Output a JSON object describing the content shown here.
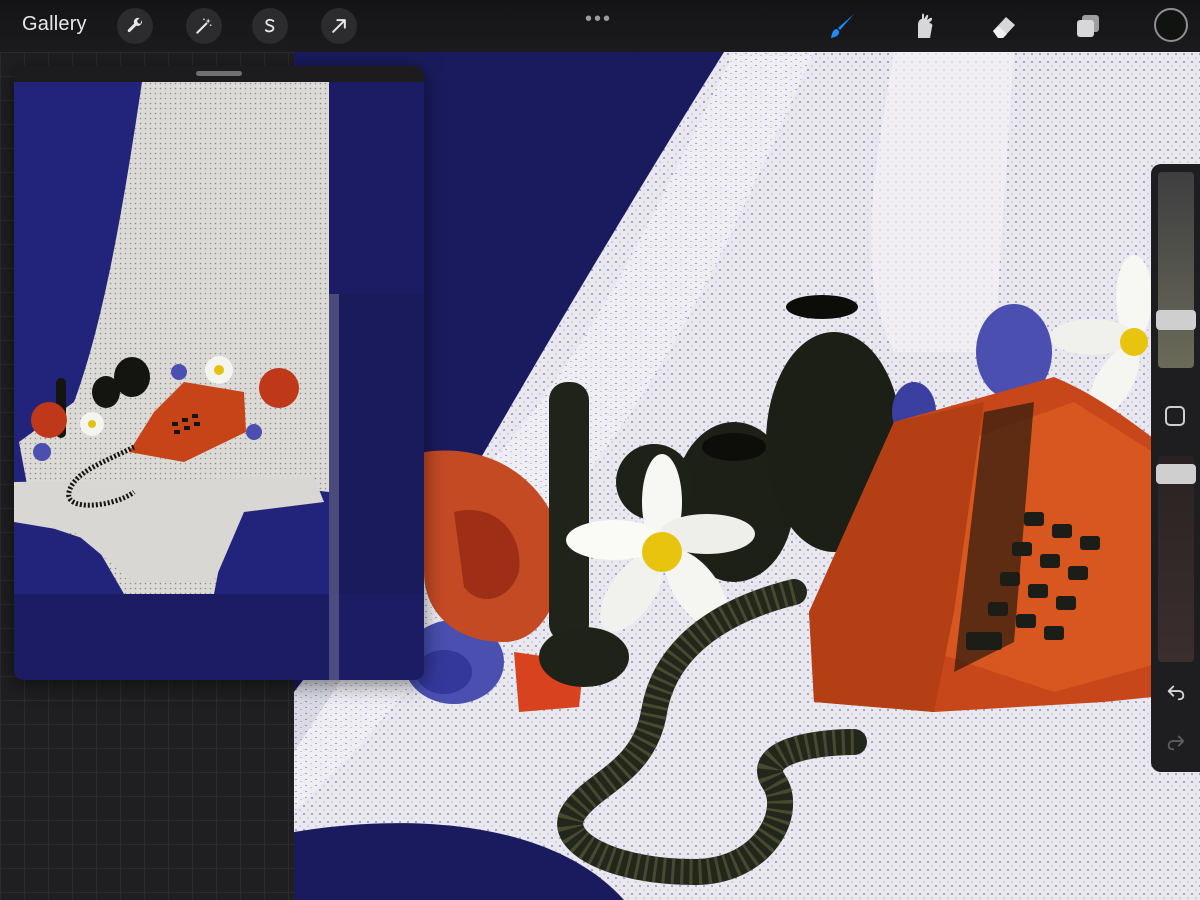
{
  "topbar": {
    "gallery_label": "Gallery",
    "left_tools": [
      "wrench-icon",
      "magic-wand-icon",
      "selection-icon",
      "transform-arrow-icon"
    ],
    "more_label": "•••",
    "right_tools": [
      "brush-icon",
      "smudge-icon",
      "eraser-icon",
      "layers-icon"
    ],
    "active_tool": "brush-icon",
    "active_color": "#111310",
    "accent_color": "#1f8bff"
  },
  "reference_panel": {
    "visible": true
  },
  "sidebar": {
    "brush_size": 0.73,
    "brush_opacity": 0.96,
    "undo_icon": "undo-icon",
    "redo_icon": "redo-icon"
  }
}
